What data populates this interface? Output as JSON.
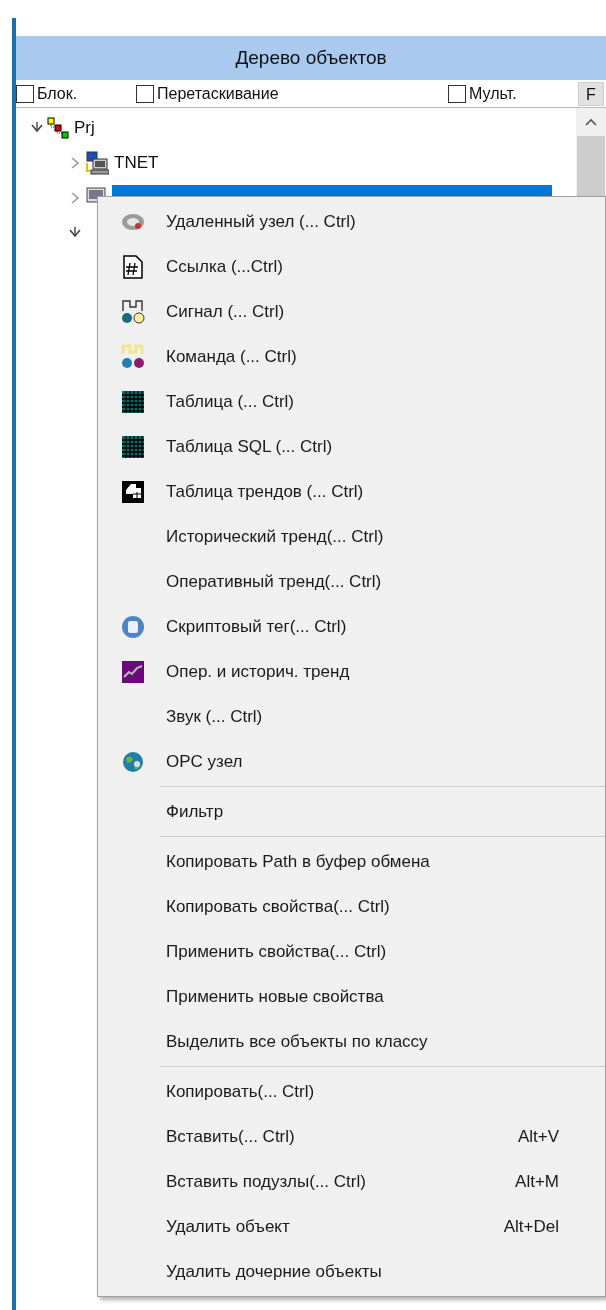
{
  "panel": {
    "title": "Дерево объектов"
  },
  "options": [
    {
      "label": "Блок.",
      "checked": false
    },
    {
      "label": "Перетаскивание",
      "checked": false
    },
    {
      "label": "Мульт.",
      "checked": false
    }
  ],
  "filter_button": "F",
  "tree": [
    {
      "label": "Prj",
      "kind": "project",
      "expanded": true,
      "selected": false,
      "children": [
        {
          "label": "TNET",
          "kind": "network",
          "expanded": false,
          "selected": false
        },
        {
          "kind": "station",
          "expanded": false,
          "selected": true
        },
        {
          "expanded": true,
          "selected": false
        }
      ]
    }
  ],
  "context_menu": {
    "groups": [
      [
        {
          "label": "Удаленный узел (... Ctrl)",
          "kind": "remote"
        },
        {
          "label": "Ссылка (...Ctrl)",
          "kind": "link"
        },
        {
          "label": "Сигнал (... Ctrl)",
          "kind": "signal"
        },
        {
          "label": "Команда (... Ctrl)",
          "kind": "command"
        },
        {
          "label": "Таблица (... Ctrl)",
          "kind": "table"
        },
        {
          "label": "Таблица SQL (... Ctrl)",
          "kind": "table"
        },
        {
          "label": "Таблица трендов (... Ctrl)",
          "kind": "trendtable"
        },
        {
          "label": "Исторический тренд(... Ctrl)"
        },
        {
          "label": "Оперативный тренд(... Ctrl)"
        },
        {
          "label": "Скриптовый тег(... Ctrl)",
          "kind": "script"
        },
        {
          "label": "Опер. и историч. тренд",
          "kind": "trend"
        },
        {
          "label": "Звук (... Ctrl)"
        },
        {
          "label": "OPC узел",
          "kind": "globe"
        }
      ],
      [
        {
          "label": "Фильтр"
        }
      ],
      [
        {
          "label": "Копировать Path в буфер обмена"
        },
        {
          "label": "Копировать свойства(... Ctrl)"
        },
        {
          "label": "Применить свойства(... Ctrl)"
        },
        {
          "label": "Применить новые свойства"
        },
        {
          "label": "Выделить все объекты по классу"
        }
      ],
      [
        {
          "label": "Копировать(... Ctrl)"
        },
        {
          "label": "Вставить(... Ctrl)",
          "shortcut": "Alt+V"
        },
        {
          "label": "Вставить подузлы(... Ctrl)",
          "shortcut": "Alt+M"
        },
        {
          "label": "Удалить объект",
          "shortcut": "Alt+Del"
        },
        {
          "label": "Удалить дочерние объекты"
        }
      ]
    ]
  }
}
